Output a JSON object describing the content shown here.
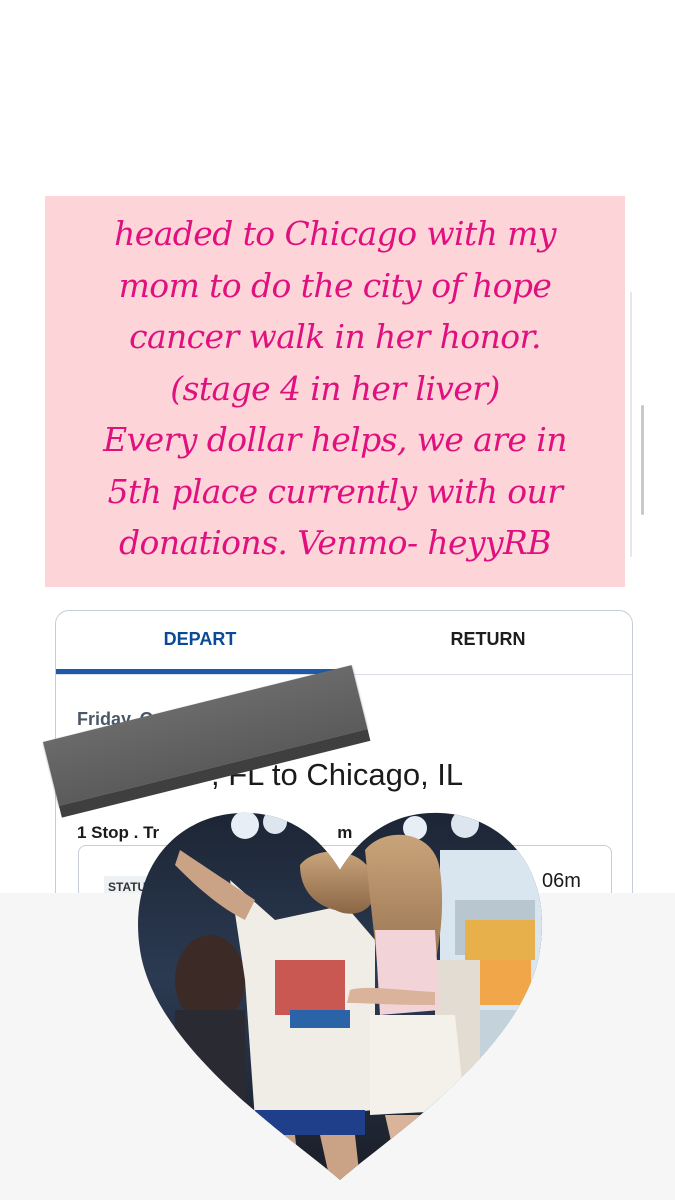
{
  "caption": {
    "text": "headed to Chicago with my\nmom to do the city of hope\ncancer walk in her honor.\n(stage 4 in her liver)\nEvery dollar helps, we are in\n5th place currently with our\ndonations. Venmo- heyyRB"
  },
  "flight_card": {
    "tabs": [
      {
        "label": "DEPART",
        "selected": true
      },
      {
        "label": "RETURN",
        "selected": false
      }
    ],
    "date_label": "Friday, O",
    "route": ", FL to Chicago, IL",
    "stops": "1 Stop . Tr",
    "stops_tail": "m",
    "status_label": "STATU",
    "duration": "06m"
  },
  "colors": {
    "caption_text": "#e0117f",
    "caption_bg": "#fdd5d9",
    "tab_accent": "#1f5aa8"
  }
}
